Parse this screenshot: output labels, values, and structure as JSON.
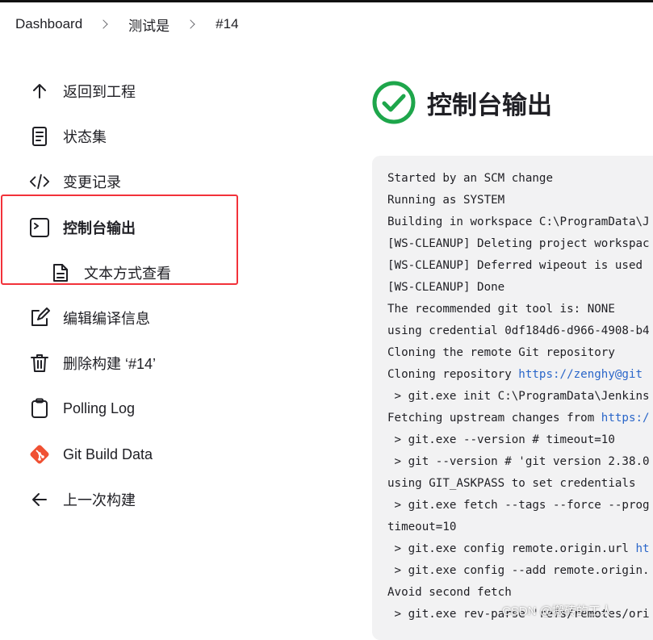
{
  "breadcrumb": [
    "Dashboard",
    "测试是",
    "#14"
  ],
  "sidebar": {
    "items": [
      {
        "label": "返回到工程",
        "icon": "arrow-up-icon"
      },
      {
        "label": "状态集",
        "icon": "document-icon"
      },
      {
        "label": "变更记录",
        "icon": "code-icon"
      },
      {
        "label": "控制台输出",
        "icon": "terminal-icon"
      },
      {
        "label": "文本方式查看",
        "icon": "file-icon"
      },
      {
        "label": "编辑编译信息",
        "icon": "edit-icon"
      },
      {
        "label": "删除构建 ‘#14’",
        "icon": "trash-icon"
      },
      {
        "label": "Polling Log",
        "icon": "clipboard-icon"
      },
      {
        "label": "Git Build Data",
        "icon": "git-icon"
      },
      {
        "label": "上一次构建",
        "icon": "arrow-left-icon"
      }
    ]
  },
  "main": {
    "title": "控制台输出"
  },
  "console": {
    "lines": [
      "Started by an SCM change",
      "Running as SYSTEM",
      "Building in workspace C:\\ProgramData\\J",
      "[WS-CLEANUP] Deleting project workspac",
      "[WS-CLEANUP] Deferred wipeout is used",
      "[WS-CLEANUP] Done",
      "The recommended git tool is: NONE",
      "using credential 0df184d6-d966-4908-b4",
      "Cloning the remote Git repository",
      "Cloning repository ",
      " > git.exe init C:\\ProgramData\\Jenkins",
      "Fetching upstream changes from ",
      " > git.exe --version # timeout=10",
      " > git --version # 'git version 2.38.0",
      "using GIT_ASKPASS to set credentials",
      " > git.exe fetch --tags --force --prog",
      "timeout=10",
      " > git.exe config remote.origin.url ",
      " > git.exe config --add remote.origin.",
      "Avoid second fetch",
      " > git.exe rev-parse 'refs/remotes/ori"
    ],
    "links": {
      "clone_url": "https://zenghy@git",
      "fetch_url": "https:/",
      "origin_url": "ht"
    }
  },
  "watermark": "CSDN @搬砖的工人",
  "colors": {
    "success": "#1ea64b",
    "redbox": "#f2323a",
    "git": "#f05133",
    "link": "#2a66c9"
  }
}
